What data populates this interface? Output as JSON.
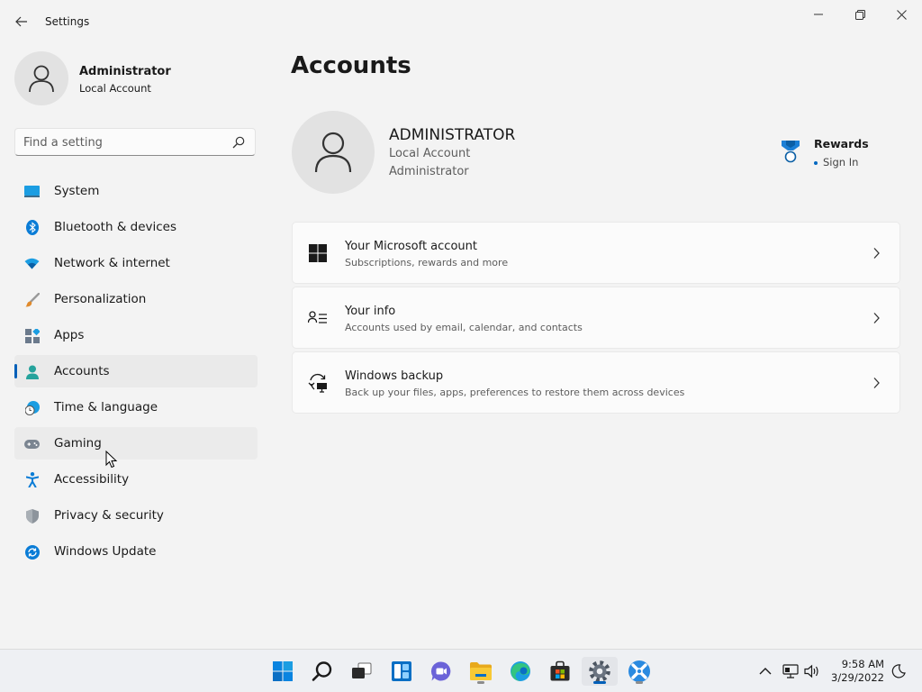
{
  "window": {
    "title": "Settings"
  },
  "profile": {
    "name": "Administrator",
    "account_type": "Local Account"
  },
  "search": {
    "placeholder": "Find a setting"
  },
  "sidebar": {
    "items": [
      {
        "label": "System",
        "icon": "monitor-icon"
      },
      {
        "label": "Bluetooth & devices",
        "icon": "bluetooth-icon"
      },
      {
        "label": "Network & internet",
        "icon": "wifi-icon"
      },
      {
        "label": "Personalization",
        "icon": "brush-icon"
      },
      {
        "label": "Apps",
        "icon": "apps-icon"
      },
      {
        "label": "Accounts",
        "icon": "person-icon",
        "active": true
      },
      {
        "label": "Time & language",
        "icon": "clock-globe-icon"
      },
      {
        "label": "Gaming",
        "icon": "gamepad-icon",
        "hovered": true
      },
      {
        "label": "Accessibility",
        "icon": "accessibility-icon"
      },
      {
        "label": "Privacy & security",
        "icon": "shield-icon"
      },
      {
        "label": "Windows Update",
        "icon": "sync-icon"
      }
    ]
  },
  "main": {
    "title": "Accounts",
    "account": {
      "name": "ADMINISTRATOR",
      "type": "Local Account",
      "role": "Administrator"
    },
    "rewards": {
      "title": "Rewards",
      "link": "Sign In"
    },
    "cards": [
      {
        "title": "Your Microsoft account",
        "subtitle": "Subscriptions, rewards and more",
        "icon": "windows-logo-icon"
      },
      {
        "title": "Your info",
        "subtitle": "Accounts used by email, calendar, and contacts",
        "icon": "contact-card-icon"
      },
      {
        "title": "Windows backup",
        "subtitle": "Back up your files, apps, preferences to restore them across devices",
        "icon": "backup-icon"
      }
    ]
  },
  "taskbar": {
    "apps": [
      "start-icon",
      "search-icon",
      "task-view-icon",
      "widgets-icon",
      "chat-icon",
      "file-explorer-icon",
      "edge-icon",
      "store-icon",
      "settings-icon",
      "app-icon"
    ],
    "time": "9:58 AM",
    "date": "3/29/2022"
  },
  "colors": {
    "accent": "#005fb8",
    "background": "#f3f3f3",
    "card": "#fbfbfb"
  }
}
